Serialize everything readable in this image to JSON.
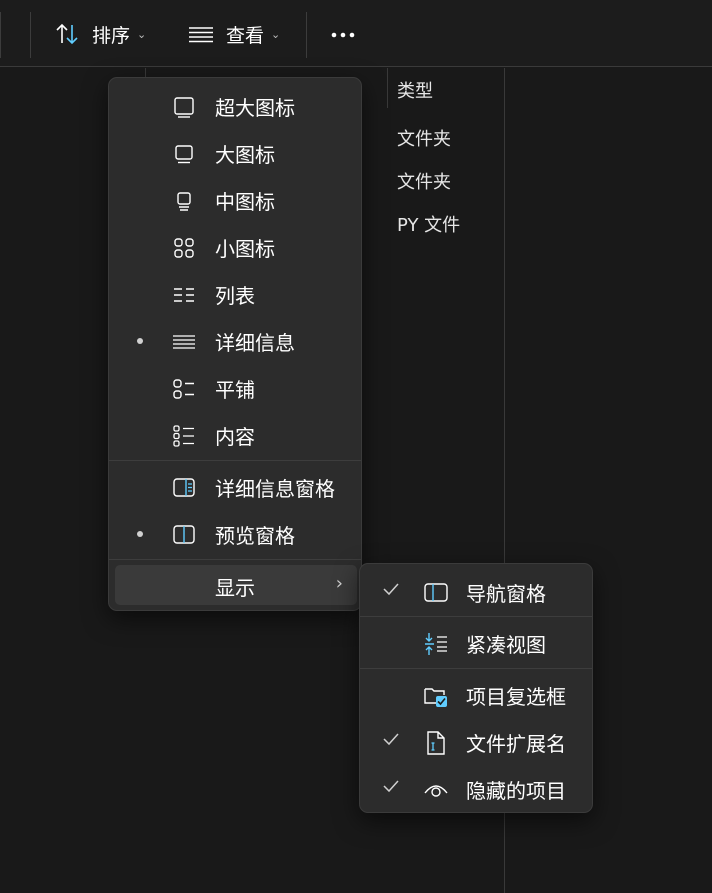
{
  "toolbar": {
    "sort_label": "排序",
    "view_label": "查看",
    "more_label": "•••"
  },
  "columns": {
    "type_header": "类型",
    "type_values": [
      "文件夹",
      "文件夹",
      "PY 文件"
    ]
  },
  "view_menu": {
    "items": [
      {
        "label": "超大图标",
        "icon": "extra-large-icons-icon",
        "selected": false
      },
      {
        "label": "大图标",
        "icon": "large-icons-icon",
        "selected": false
      },
      {
        "label": "中图标",
        "icon": "medium-icons-icon",
        "selected": false
      },
      {
        "label": "小图标",
        "icon": "small-icons-icon",
        "selected": false
      },
      {
        "label": "列表",
        "icon": "list-icon",
        "selected": false
      },
      {
        "label": "详细信息",
        "icon": "details-icon",
        "selected": true
      },
      {
        "label": "平铺",
        "icon": "tiles-icon",
        "selected": false
      },
      {
        "label": "内容",
        "icon": "content-icon",
        "selected": false
      },
      {
        "label": "详细信息窗格",
        "icon": "details-pane-icon",
        "selected": false
      },
      {
        "label": "预览窗格",
        "icon": "preview-pane-icon",
        "selected": true
      }
    ],
    "show_label": "显示"
  },
  "show_submenu": {
    "items": [
      {
        "label": "导航窗格",
        "icon": "navigation-pane-icon",
        "checked": true
      },
      {
        "label": "紧凑视图",
        "icon": "compact-view-icon",
        "checked": false
      },
      {
        "label": "项目复选框",
        "icon": "item-checkboxes-icon",
        "checked": false
      },
      {
        "label": "文件扩展名",
        "icon": "file-extensions-icon",
        "checked": true
      },
      {
        "label": "隐藏的项目",
        "icon": "hidden-items-icon",
        "checked": true
      }
    ]
  },
  "colors": {
    "accent": "#60cdff",
    "menu_bg": "#2c2c2c",
    "page_bg": "#191919"
  }
}
